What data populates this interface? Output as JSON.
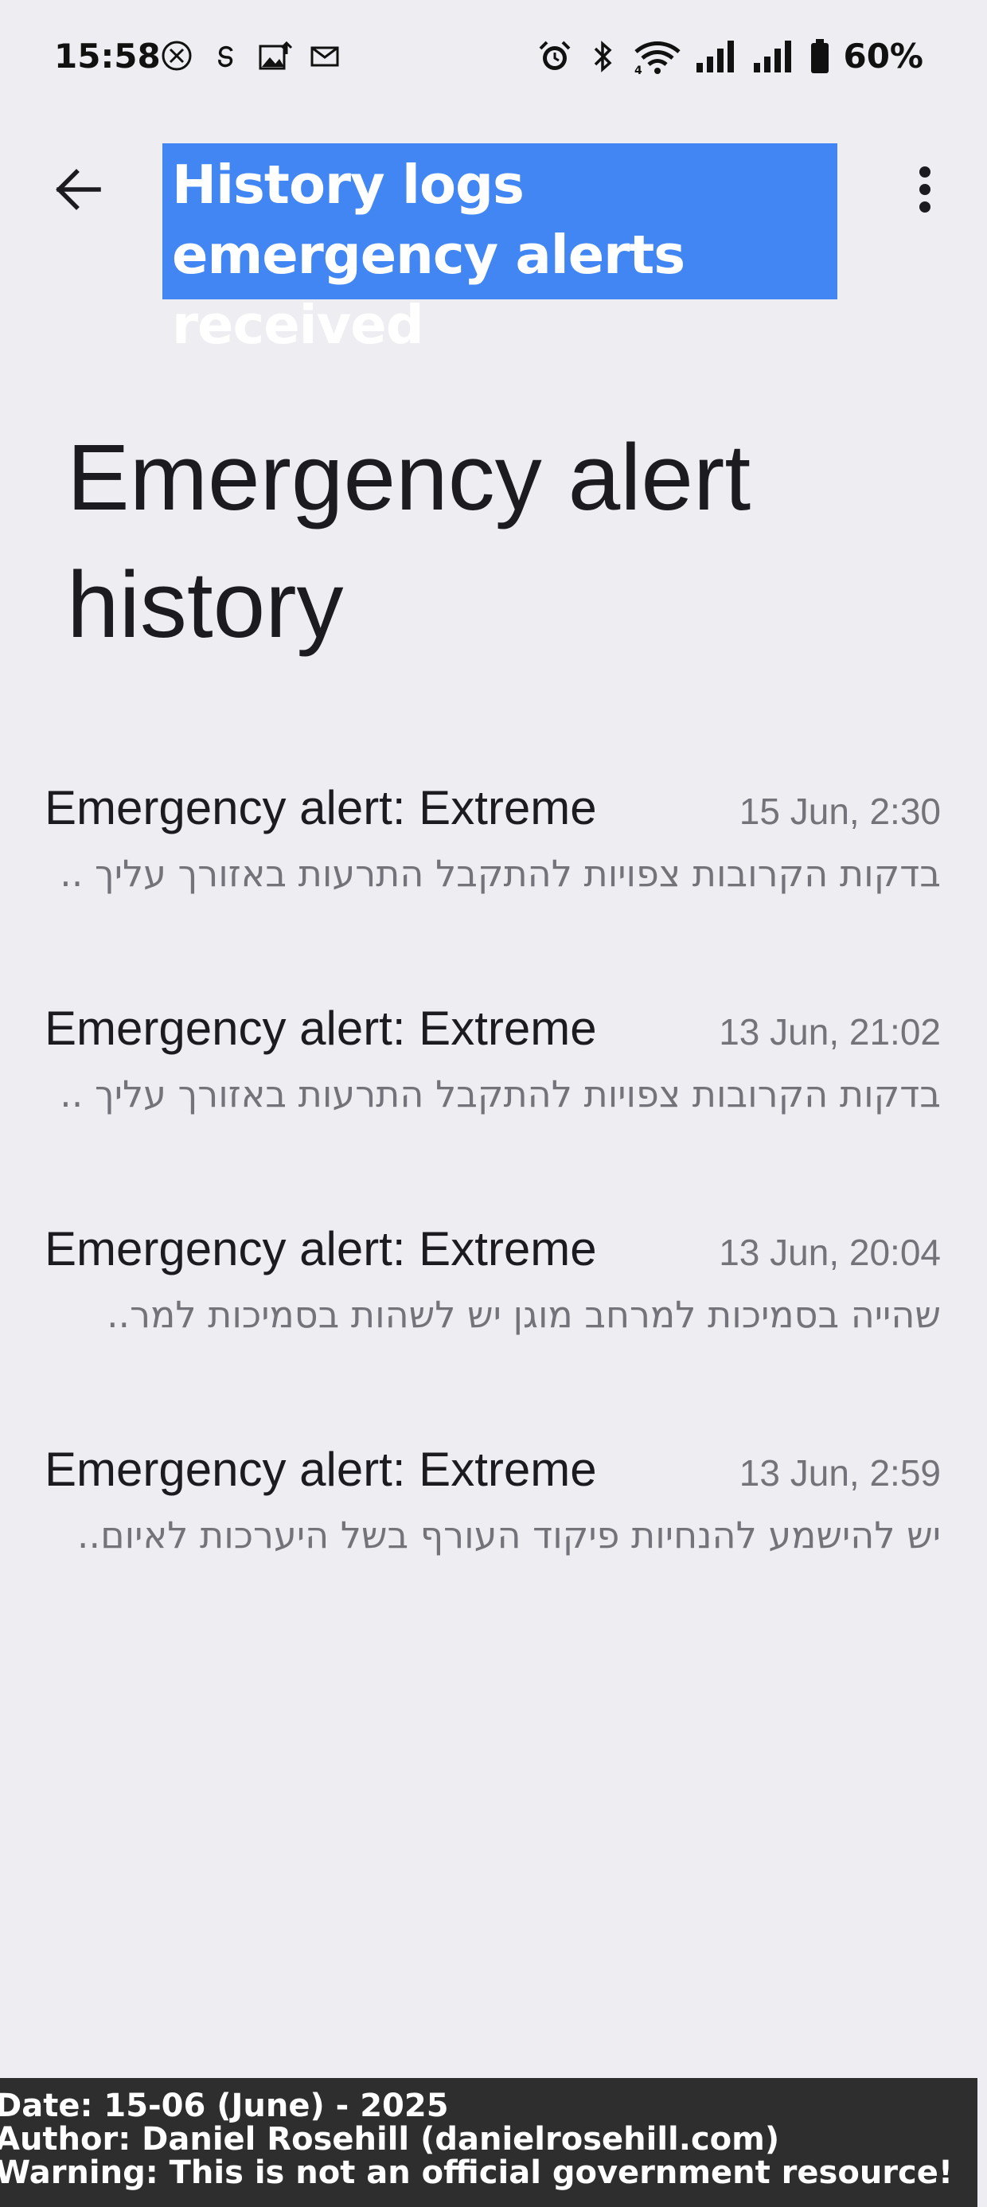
{
  "status_bar": {
    "time": "15:58",
    "left_icons": [
      "x-app-icon",
      "threads-icon",
      "photo-upload-icon",
      "mail-icon"
    ],
    "right_icons": [
      "alarm-icon",
      "bluetooth-icon",
      "wifi-icon",
      "signal-icon",
      "signal-icon",
      "battery-icon"
    ],
    "battery": "60%"
  },
  "app_bar": {
    "back_icon": "arrow-back-icon",
    "more_icon": "more-vert-icon"
  },
  "banner": {
    "text": "History logs emergency alerts received",
    "color": "#4286f4"
  },
  "page": {
    "title": "Emergency alert history"
  },
  "alerts": [
    {
      "title": "Emergency alert: Extreme",
      "time": "15 Jun, 2:30",
      "body": "בדקות הקרובות צפויות להתקבל התרעות באזורך  עליך .."
    },
    {
      "title": "Emergency alert: Extreme",
      "time": "13 Jun, 21:02",
      "body": "בדקות הקרובות צפויות להתקבל התרעות באזורך  עליך .."
    },
    {
      "title": "Emergency alert: Extreme",
      "time": "13 Jun, 20:04",
      "body": "שהייה בסמיכות למרחב מוגן  יש לשהות בסמיכות למר.."
    },
    {
      "title": "Emergency alert: Extreme",
      "time": "13 Jun, 2:59",
      "body": "יש להישמע להנחיות פיקוד העורף  בשל היערכות לאיום.."
    }
  ],
  "footer": {
    "date_line": "Date: 15-06 (June) - 2025",
    "author_line": "Author: Daniel Rosehill (danielrosehill.com)",
    "warning_line": "Warning: This is not an official government resource!"
  }
}
